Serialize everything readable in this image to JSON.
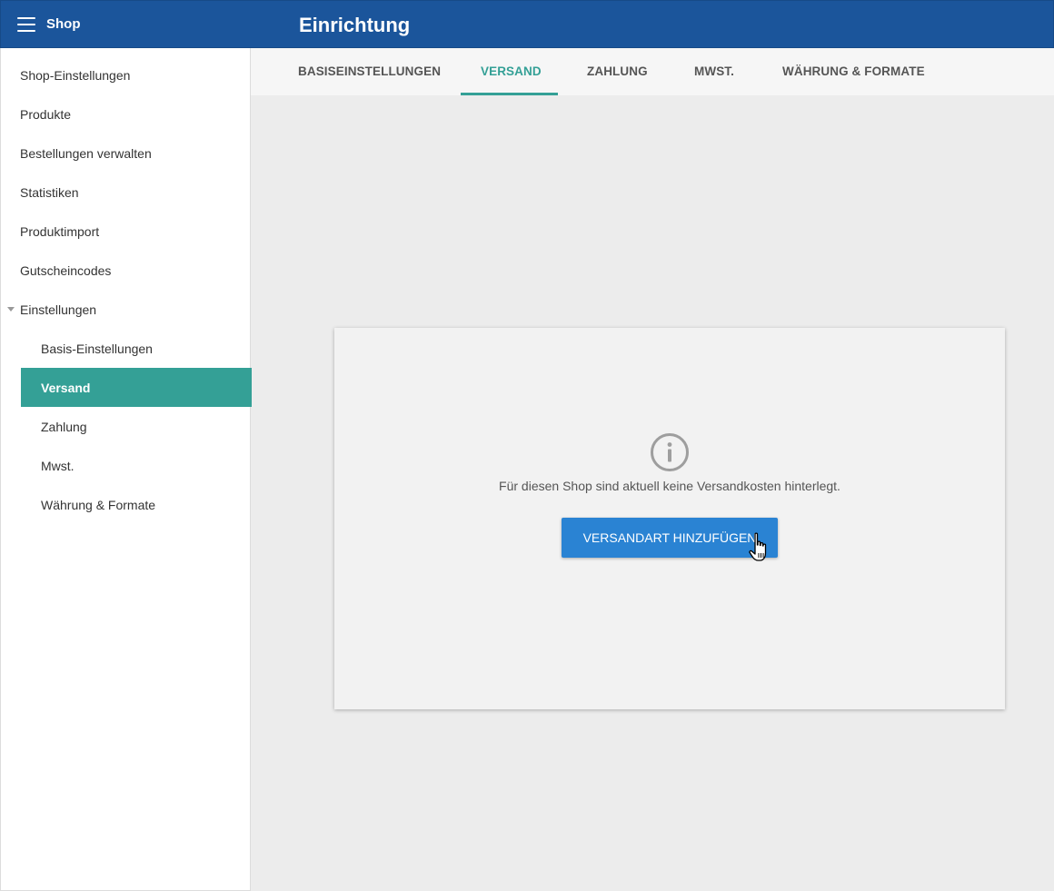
{
  "header": {
    "menu_icon": "hamburger-menu-icon",
    "shop_label": "Shop",
    "title": "Einrichtung"
  },
  "sidebar": {
    "items": [
      {
        "label": "Shop-Einstellungen"
      },
      {
        "label": "Produkte"
      },
      {
        "label": "Bestellungen verwalten"
      },
      {
        "label": "Statistiken"
      },
      {
        "label": "Produktimport"
      },
      {
        "label": "Gutscheincodes"
      },
      {
        "label": "Einstellungen",
        "expanded": true
      }
    ],
    "subitems": [
      {
        "label": "Basis-Einstellungen"
      },
      {
        "label": "Versand",
        "active": true
      },
      {
        "label": "Zahlung"
      },
      {
        "label": "Mwst."
      },
      {
        "label": "Währung & Formate"
      }
    ]
  },
  "tabs": [
    {
      "label": "BASISEINSTELLUNGEN"
    },
    {
      "label": "VERSAND",
      "active": true
    },
    {
      "label": "ZAHLUNG"
    },
    {
      "label": "MWST."
    },
    {
      "label": "WÄHRUNG & FORMATE"
    }
  ],
  "empty_state": {
    "icon": "info-icon",
    "message": "Für diesen Shop sind aktuell keine Versandkosten hinterlegt.",
    "button_label": "VERSANDART HINZUFÜGEN"
  },
  "colors": {
    "header": "#1b559b",
    "accent": "#34a096",
    "button": "#2a83d3",
    "background": "#ececec"
  }
}
